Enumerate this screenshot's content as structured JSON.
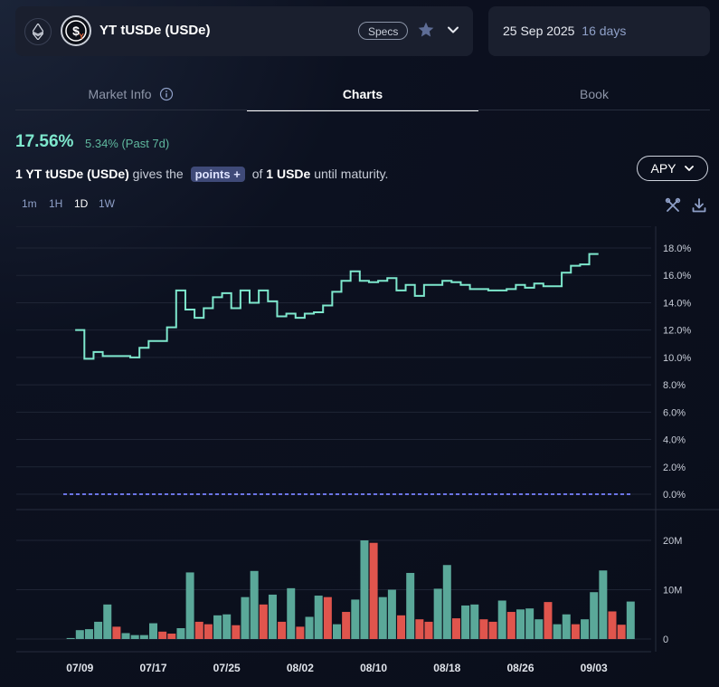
{
  "header": {
    "network_icon": "ethereum-icon",
    "token_name": "YT tUSDe (USDe)",
    "specs_label": "Specs",
    "favorite_icon": "star-icon",
    "expand_icon": "chevron-down-icon",
    "maturity_date": "25 Sep 2025",
    "days_left": "16 days"
  },
  "tabs": [
    {
      "label": "Market Info",
      "active": false,
      "icon": "info-icon"
    },
    {
      "label": "Charts",
      "active": true
    },
    {
      "label": "Book",
      "active": false
    }
  ],
  "summary": {
    "apy_value": "17.56%",
    "apy_change": "5.34% (Past 7d)",
    "desc_lead": "1 YT tUSDe (USDe)",
    "desc_mid": "gives the",
    "points_label": "points",
    "desc_of": "of",
    "desc_amount": "1 USDe",
    "desc_tail": "until maturity."
  },
  "metric_select": {
    "label": "APY",
    "icon": "chevron-down-icon"
  },
  "timeframes": [
    {
      "label": "1m",
      "active": false
    },
    {
      "label": "1H",
      "active": false
    },
    {
      "label": "1D",
      "active": true
    },
    {
      "label": "1W",
      "active": false
    }
  ],
  "tools": {
    "settings_icon": "tools-icon",
    "download_icon": "download-icon"
  },
  "colors": {
    "apy_line": "#7ee8cd",
    "volume_up": "#5aa899",
    "volume_down": "#e0554d",
    "reference_line": "#6b74e6",
    "accent_text": "#5fb89e"
  },
  "chart_data": [
    {
      "type": "line",
      "name": "",
      "x": [
        "07/08",
        "07/09",
        "07/10",
        "07/11",
        "07/12",
        "07/13",
        "07/14",
        "07/15",
        "07/16",
        "07/17",
        "07/18",
        "07/19",
        "07/20",
        "07/21",
        "07/22",
        "07/23",
        "07/24",
        "07/25",
        "07/26",
        "07/27",
        "07/28",
        "07/29",
        "07/30",
        "07/31",
        "08/01",
        "08/02",
        "08/03",
        "08/04",
        "08/05",
        "08/06",
        "08/07",
        "08/08",
        "08/09",
        "08/10",
        "08/11",
        "08/12",
        "08/13",
        "08/14",
        "08/15",
        "08/16",
        "08/17",
        "08/18",
        "08/19",
        "08/20",
        "08/21",
        "08/22",
        "08/23",
        "08/24",
        "08/25",
        "08/26",
        "08/27",
        "08/28",
        "08/29",
        "08/30",
        "08/31",
        "09/01",
        "09/02",
        "09/03",
        "09/04",
        "09/05",
        "09/06",
        "09/07",
        "09/08"
      ],
      "values": [
        12.0,
        9.9,
        10.4,
        10.1,
        10.1,
        10.1,
        10.0,
        10.7,
        11.2,
        11.2,
        12.2,
        14.9,
        13.5,
        12.9,
        13.6,
        14.4,
        14.7,
        13.6,
        14.9,
        14.0,
        14.9,
        14.1,
        13.0,
        13.2,
        12.9,
        13.2,
        13.3,
        13.8,
        14.8,
        15.6,
        16.3,
        15.6,
        15.5,
        15.6,
        15.8,
        14.9,
        15.3,
        14.5,
        15.3,
        15.3,
        15.6,
        15.5,
        15.3,
        15.0,
        15.0,
        14.9,
        14.9,
        15.0,
        15.3,
        15.1,
        15.4,
        15.2,
        15.2,
        16.2,
        16.7,
        16.8,
        17.56
      ],
      "y_unit": "%",
      "y_ticks": [
        "0.0%",
        "2.0%",
        "4.0%",
        "6.0%",
        "8.0%",
        "10.0%",
        "12.0%",
        "14.0%",
        "16.0%",
        "18.0%"
      ],
      "ylim": [
        0,
        19
      ],
      "reference_line": 0.0,
      "grid": "horizontal"
    },
    {
      "type": "bar",
      "name": "",
      "categories": [
        "07/08",
        "07/09",
        "07/10",
        "07/11",
        "07/12",
        "07/13",
        "07/14",
        "07/15",
        "07/16",
        "07/17",
        "07/18",
        "07/19",
        "07/20",
        "07/21",
        "07/22",
        "07/23",
        "07/24",
        "07/25",
        "07/26",
        "07/27",
        "07/28",
        "07/29",
        "07/30",
        "07/31",
        "08/01",
        "08/02",
        "08/03",
        "08/04",
        "08/05",
        "08/06",
        "08/07",
        "08/08",
        "08/09",
        "08/10",
        "08/11",
        "08/12",
        "08/13",
        "08/14",
        "08/15",
        "08/16",
        "08/17",
        "08/18",
        "08/19",
        "08/20",
        "08/21",
        "08/22",
        "08/23",
        "08/24",
        "08/25",
        "08/26",
        "08/27",
        "08/28",
        "08/29",
        "08/30",
        "08/31",
        "09/01",
        "09/02",
        "09/03",
        "09/04",
        "09/05",
        "09/06",
        "09/07",
        "09/08"
      ],
      "values": [
        0.2,
        1.8,
        2.0,
        3.5,
        7.0,
        2.5,
        1.2,
        0.8,
        0.8,
        3.2,
        1.5,
        1.1,
        2.2,
        13.5,
        3.5,
        3.0,
        4.8,
        5.0,
        2.8,
        8.5,
        13.8,
        7.0,
        9.0,
        3.5,
        10.3,
        2.5,
        4.5,
        8.8,
        8.5,
        3.0,
        5.5,
        8.0,
        20.0,
        19.5,
        8.5,
        10.0,
        4.8,
        13.4,
        4.0,
        3.5,
        10.2,
        15.0,
        4.2,
        6.8,
        7.0,
        4.0,
        3.5,
        7.8,
        5.5,
        6.0,
        6.2,
        4.0,
        7.5,
        3.0,
        5.0,
        3.0,
        4.0,
        9.5,
        13.9,
        5.6,
        2.9,
        7.6
      ],
      "direction": [
        "up",
        "up",
        "up",
        "up",
        "up",
        "down",
        "up",
        "up",
        "up",
        "up",
        "down",
        "down",
        "up",
        "up",
        "down",
        "down",
        "up",
        "up",
        "down",
        "up",
        "up",
        "down",
        "up",
        "down",
        "up",
        "down",
        "up",
        "up",
        "down",
        "up",
        "down",
        "up",
        "up",
        "down",
        "up",
        "up",
        "down",
        "up",
        "down",
        "down",
        "up",
        "up",
        "down",
        "up",
        "up",
        "down",
        "down",
        "up",
        "down",
        "up",
        "up",
        "up",
        "down",
        "up",
        "up",
        "down",
        "up",
        "up",
        "up",
        "down",
        "down",
        "up"
      ],
      "y_ticks": [
        "0",
        "10M",
        "20M"
      ],
      "ylim": [
        0,
        20
      ],
      "y_unit": "M",
      "x_tick_labels": [
        "07/09",
        "07/17",
        "07/25",
        "08/02",
        "08/10",
        "08/18",
        "08/26",
        "09/03"
      ]
    }
  ]
}
